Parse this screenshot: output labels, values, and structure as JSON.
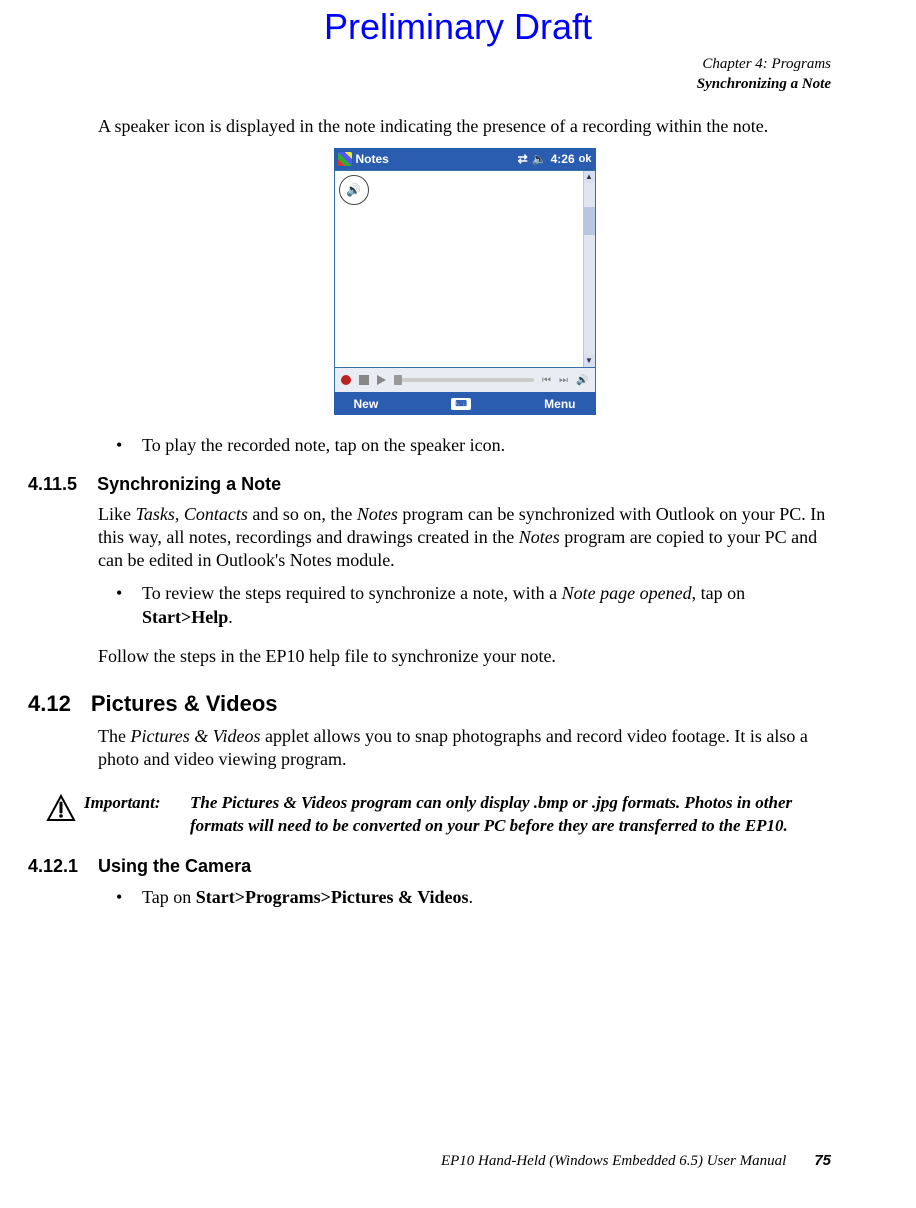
{
  "watermark": "Preliminary Draft",
  "header": {
    "chapter": "Chapter 4: Programs",
    "section": "Synchronizing a Note"
  },
  "intro_para": "A speaker icon is displayed in the note indicating the presence of a recording within the note.",
  "pda": {
    "title": "Notes",
    "time": "4:26",
    "ok": "ok",
    "new": "New",
    "menu": "Menu"
  },
  "bullet_play": "To play the recorded note, tap on the speaker icon.",
  "sec_4_11_5": {
    "num": "4.11.5",
    "title": "Synchronizing a Note",
    "para_pre": "Like ",
    "para_ital1": "Tasks, Contacts",
    "para_mid1": " and so on, the ",
    "para_ital2": "Notes",
    "para_mid2": " program can be synchronized with Outlook on your PC. In this way, all notes, recordings and drawings created in the ",
    "para_ital3": "Notes",
    "para_mid3": " program are copied to your PC and can be edited in Outlook's Notes module.",
    "bullet_pre": "To review the steps required to synchronize a note, with a ",
    "bullet_ital": "Note page opened",
    "bullet_mid": ", tap on ",
    "bullet_bold": "Start>Help",
    "bullet_post": ".",
    "follow": "Follow the steps in the EP10 help file to synchronize your note."
  },
  "sec_4_12": {
    "num": "4.12",
    "title": "Pictures & Videos",
    "para_pre": "The ",
    "para_ital": "Pictures & Videos",
    "para_post": " applet allows you to snap photographs and record video footage. It is also a photo and video viewing program."
  },
  "important": {
    "label": "Important:",
    "text": "The Pictures & Videos program can only display .bmp or .jpg formats. Photos in other formats will need to be converted on your PC before they are transferred to the EP10."
  },
  "sec_4_12_1": {
    "num": "4.12.1",
    "title": "Using the Camera",
    "bullet_pre": "Tap on ",
    "bullet_bold": "Start>Programs>Pictures & Videos",
    "bullet_post": "."
  },
  "footer": {
    "manual": "EP10 Hand-Held (Windows Embedded 6.5) User Manual",
    "page": "75"
  }
}
